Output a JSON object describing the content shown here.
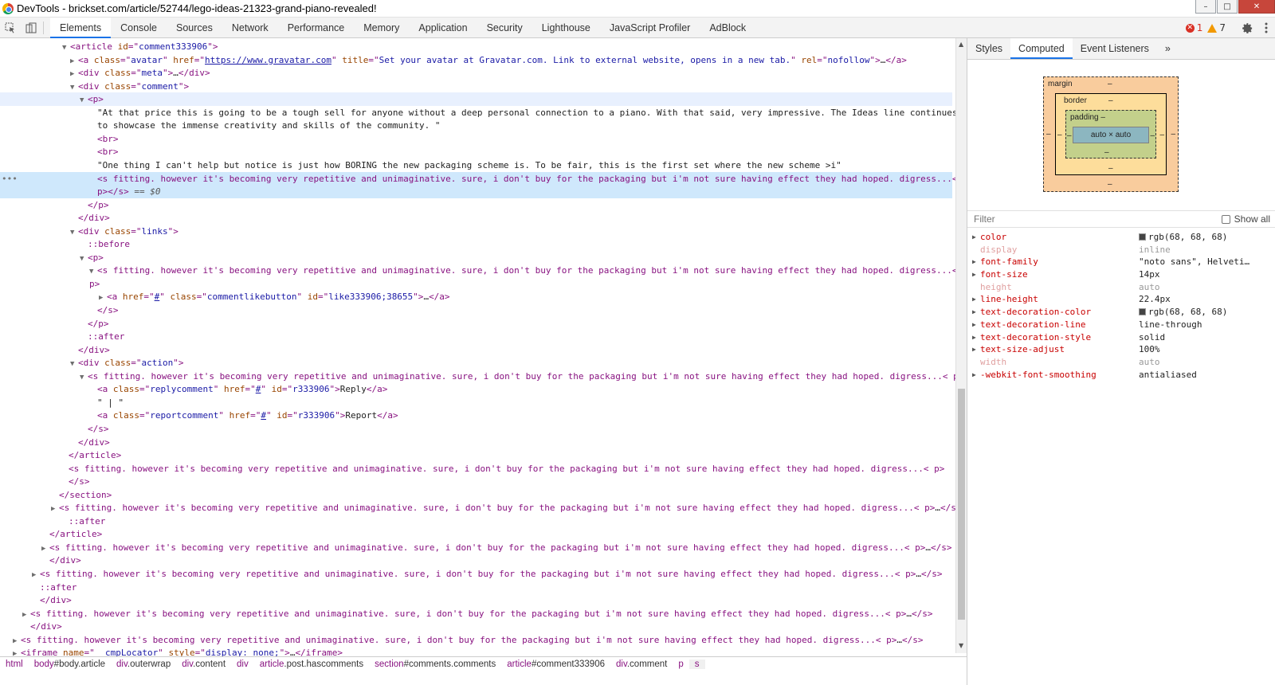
{
  "window": {
    "title": "DevTools - brickset.com/article/52744/lego-ideas-21323-grand-piano-revealed!",
    "min": "–",
    "max": "□",
    "close": "✕"
  },
  "toolbar": {
    "tabs": [
      "Elements",
      "Console",
      "Sources",
      "Network",
      "Performance",
      "Memory",
      "Application",
      "Security",
      "Lighthouse",
      "JavaScript Profiler",
      "AdBlock"
    ],
    "active_tab": "Elements",
    "errors": "1",
    "warnings": "7"
  },
  "dom_lines": [
    {
      "indent": 88,
      "arrow": "▼",
      "parts": [
        [
          "tag",
          "<article "
        ],
        [
          "attr",
          "id"
        ],
        [
          "tag",
          "=\""
        ],
        [
          "val",
          "comment333906"
        ],
        [
          "tag",
          "\">"
        ]
      ]
    },
    {
      "indent": 98,
      "arrow": "▶",
      "parts": [
        [
          "tag",
          "<a "
        ],
        [
          "attr",
          "class"
        ],
        [
          "tag",
          "=\""
        ],
        [
          "val",
          "avatar"
        ],
        [
          "tag",
          "\" "
        ],
        [
          "attr",
          "href"
        ],
        [
          "tag",
          "=\""
        ],
        [
          "link",
          "https://www.gravatar.com"
        ],
        [
          "tag",
          "\" "
        ],
        [
          "attr",
          "title"
        ],
        [
          "tag",
          "=\""
        ],
        [
          "val",
          "Set your avatar at Gravatar.com. Link to external website, opens in a new tab."
        ],
        [
          "tag",
          "\" "
        ],
        [
          "attr",
          "rel"
        ],
        [
          "tag",
          "=\""
        ],
        [
          "val",
          "nofollow"
        ],
        [
          "tag",
          "\">"
        ],
        [
          "txt",
          "…"
        ],
        [
          "tag",
          "</a>"
        ]
      ]
    },
    {
      "indent": 98,
      "arrow": "▶",
      "parts": [
        [
          "tag",
          "<div "
        ],
        [
          "attr",
          "class"
        ],
        [
          "tag",
          "=\""
        ],
        [
          "val",
          "meta"
        ],
        [
          "tag",
          "\">"
        ],
        [
          "txt",
          "…"
        ],
        [
          "tag",
          "</div>"
        ]
      ]
    },
    {
      "indent": 98,
      "arrow": "▼",
      "parts": [
        [
          "tag",
          "<div "
        ],
        [
          "attr",
          "class"
        ],
        [
          "tag",
          "=\""
        ],
        [
          "val",
          "comment"
        ],
        [
          "tag",
          "\">"
        ]
      ]
    },
    {
      "indent": 110,
      "arrow": "▼",
      "hover": true,
      "parts": [
        [
          "tag",
          "<p>"
        ]
      ]
    },
    {
      "indent": 122,
      "arrow": "",
      "parts": [
        [
          "txt",
          "\"At that price this is going to be a tough sell for anyone without a deep personal connection to a piano. With that said, very impressive. The Ideas line continues"
        ]
      ]
    },
    {
      "indent": 122,
      "arrow": "",
      "parts": [
        [
          "txt",
          "to showcase the immense creativity and skills of the community. \""
        ]
      ]
    },
    {
      "indent": 122,
      "arrow": "",
      "parts": [
        [
          "tag",
          "<br>"
        ]
      ]
    },
    {
      "indent": 122,
      "arrow": "",
      "parts": [
        [
          "tag",
          "<br>"
        ]
      ]
    },
    {
      "indent": 122,
      "arrow": "",
      "parts": [
        [
          "txt",
          "\"One thing I can't help but notice is just how BORING the new packaging scheme is. To be fair, this is the first set where the new scheme >i\""
        ]
      ]
    },
    {
      "indent": 122,
      "arrow": "",
      "selected": true,
      "dots": "•••",
      "parts": [
        [
          "tag",
          "<s fitting. however it's becoming very repetitive and unimaginative. sure, i don't buy for the packaging but i'm not sure having effect they had hoped. digress...<"
        ]
      ]
    },
    {
      "indent": 122,
      "arrow": "",
      "selected": true,
      "parts": [
        [
          "tag",
          "p></s>"
        ],
        [
          "dim",
          " == $0"
        ]
      ]
    },
    {
      "indent": 110,
      "arrow": "",
      "parts": [
        [
          "tag",
          "</p>"
        ]
      ]
    },
    {
      "indent": 98,
      "arrow": "",
      "parts": [
        [
          "tag",
          "</div>"
        ]
      ]
    },
    {
      "indent": 98,
      "arrow": "▼",
      "parts": [
        [
          "tag",
          "<div "
        ],
        [
          "attr",
          "class"
        ],
        [
          "tag",
          "=\""
        ],
        [
          "val",
          "links"
        ],
        [
          "tag",
          "\">"
        ]
      ]
    },
    {
      "indent": 110,
      "arrow": "",
      "parts": [
        [
          "pseudo",
          "::before"
        ]
      ]
    },
    {
      "indent": 110,
      "arrow": "▼",
      "parts": [
        [
          "tag",
          "<p>"
        ]
      ]
    },
    {
      "indent": 122,
      "arrow": "▼",
      "parts": [
        [
          "tag",
          "<s fitting. however it's becoming very repetitive and unimaginative. sure, i don't buy for the packaging but i'm not sure having effect they had hoped. digress...<"
        ]
      ]
    },
    {
      "indent": 112,
      "arrow": "",
      "parts": [
        [
          "tag",
          "p>"
        ]
      ]
    },
    {
      "indent": 134,
      "arrow": "▶",
      "parts": [
        [
          "tag",
          "<a "
        ],
        [
          "attr",
          "href"
        ],
        [
          "tag",
          "=\""
        ],
        [
          "link",
          "#"
        ],
        [
          "tag",
          "\" "
        ],
        [
          "attr",
          "class"
        ],
        [
          "tag",
          "=\""
        ],
        [
          "val",
          "commentlikebutton"
        ],
        [
          "tag",
          "\" "
        ],
        [
          "attr",
          "id"
        ],
        [
          "tag",
          "=\""
        ],
        [
          "val",
          "like333906;38655"
        ],
        [
          "tag",
          "\">"
        ],
        [
          "txt",
          "…"
        ],
        [
          "tag",
          "</a>"
        ]
      ]
    },
    {
      "indent": 122,
      "arrow": "",
      "parts": [
        [
          "tag",
          "</s>"
        ]
      ]
    },
    {
      "indent": 110,
      "arrow": "",
      "parts": [
        [
          "tag",
          "</p>"
        ]
      ]
    },
    {
      "indent": 110,
      "arrow": "",
      "parts": [
        [
          "pseudo",
          "::after"
        ]
      ]
    },
    {
      "indent": 98,
      "arrow": "",
      "parts": [
        [
          "tag",
          "</div>"
        ]
      ]
    },
    {
      "indent": 98,
      "arrow": "▼",
      "parts": [
        [
          "tag",
          "<div "
        ],
        [
          "attr",
          "class"
        ],
        [
          "tag",
          "=\""
        ],
        [
          "val",
          "action"
        ],
        [
          "tag",
          "\">"
        ]
      ]
    },
    {
      "indent": 110,
      "arrow": "▼",
      "parts": [
        [
          "tag",
          "<s fitting. however it's becoming very repetitive and unimaginative. sure, i don't buy for the packaging but i'm not sure having effect they had hoped. digress...< p>"
        ]
      ]
    },
    {
      "indent": 122,
      "arrow": "",
      "parts": [
        [
          "tag",
          "<a "
        ],
        [
          "attr",
          "class"
        ],
        [
          "tag",
          "=\""
        ],
        [
          "val",
          "replycomment"
        ],
        [
          "tag",
          "\" "
        ],
        [
          "attr",
          "href"
        ],
        [
          "tag",
          "=\""
        ],
        [
          "link",
          "#"
        ],
        [
          "tag",
          "\" "
        ],
        [
          "attr",
          "id"
        ],
        [
          "tag",
          "=\""
        ],
        [
          "val",
          "r333906"
        ],
        [
          "tag",
          "\">"
        ],
        [
          "txt",
          "Reply"
        ],
        [
          "tag",
          "</a>"
        ]
      ]
    },
    {
      "indent": 122,
      "arrow": "",
      "parts": [
        [
          "txt",
          "\" | \""
        ]
      ]
    },
    {
      "indent": 122,
      "arrow": "",
      "parts": [
        [
          "tag",
          "<a "
        ],
        [
          "attr",
          "class"
        ],
        [
          "tag",
          "=\""
        ],
        [
          "val",
          "reportcomment"
        ],
        [
          "tag",
          "\" "
        ],
        [
          "attr",
          "href"
        ],
        [
          "tag",
          "=\""
        ],
        [
          "link",
          "#"
        ],
        [
          "tag",
          "\" "
        ],
        [
          "attr",
          "id"
        ],
        [
          "tag",
          "=\""
        ],
        [
          "val",
          "r333906"
        ],
        [
          "tag",
          "\">"
        ],
        [
          "txt",
          "Report"
        ],
        [
          "tag",
          "</a>"
        ]
      ]
    },
    {
      "indent": 110,
      "arrow": "",
      "parts": [
        [
          "tag",
          "</s>"
        ]
      ]
    },
    {
      "indent": 98,
      "arrow": "",
      "parts": [
        [
          "tag",
          "</div>"
        ]
      ]
    },
    {
      "indent": 86,
      "arrow": "",
      "parts": [
        [
          "tag",
          "</article>"
        ]
      ]
    },
    {
      "indent": 86,
      "arrow": "",
      "parts": [
        [
          "tag",
          "<s fitting. however it's becoming very repetitive and unimaginative. sure, i don't buy for the packaging but i'm not sure having effect they had hoped. digress...< p>"
        ]
      ]
    },
    {
      "indent": 86,
      "arrow": "",
      "parts": [
        [
          "tag",
          "</s>"
        ]
      ]
    },
    {
      "indent": 74,
      "arrow": "",
      "parts": [
        [
          "tag",
          "</section>"
        ]
      ]
    },
    {
      "indent": 74,
      "arrow": "▶",
      "parts": [
        [
          "tag",
          "<s fitting. however it's becoming very repetitive and unimaginative. sure, i don't buy for the packaging but i'm not sure having effect they had hoped. digress...< p>"
        ],
        [
          "txt",
          "…"
        ],
        [
          "tag",
          "</s>"
        ]
      ]
    },
    {
      "indent": 86,
      "arrow": "",
      "parts": [
        [
          "pseudo",
          "::after"
        ]
      ]
    },
    {
      "indent": 62,
      "arrow": "",
      "parts": [
        [
          "tag",
          "</article>"
        ]
      ]
    },
    {
      "indent": 62,
      "arrow": "▶",
      "parts": [
        [
          "tag",
          "<s fitting. however it's becoming very repetitive and unimaginative. sure, i don't buy for the packaging but i'm not sure having effect they had hoped. digress...< p>"
        ],
        [
          "txt",
          "…"
        ],
        [
          "tag",
          "</s>"
        ]
      ]
    },
    {
      "indent": 62,
      "arrow": "",
      "parts": [
        [
          "tag",
          "</div>"
        ]
      ]
    },
    {
      "indent": 50,
      "arrow": "▶",
      "parts": [
        [
          "tag",
          "<s fitting. however it's becoming very repetitive and unimaginative. sure, i don't buy for the packaging but i'm not sure having effect they had hoped. digress...< p>"
        ],
        [
          "txt",
          "…"
        ],
        [
          "tag",
          "</s>"
        ]
      ]
    },
    {
      "indent": 50,
      "arrow": "",
      "parts": [
        [
          "pseudo",
          "::after"
        ]
      ]
    },
    {
      "indent": 50,
      "arrow": "",
      "parts": [
        [
          "tag",
          "</div>"
        ]
      ]
    },
    {
      "indent": 38,
      "arrow": "▶",
      "parts": [
        [
          "tag",
          "<s fitting. however it's becoming very repetitive and unimaginative. sure, i don't buy for the packaging but i'm not sure having effect they had hoped. digress...< p>"
        ],
        [
          "txt",
          "…"
        ],
        [
          "tag",
          "</s>"
        ]
      ]
    },
    {
      "indent": 38,
      "arrow": "",
      "parts": [
        [
          "tag",
          "</div>"
        ]
      ]
    },
    {
      "indent": 26,
      "arrow": "▶",
      "parts": [
        [
          "tag",
          "<s fitting. however it's becoming very repetitive and unimaginative. sure, i don't buy for the packaging but i'm not sure having effect they had hoped. digress...< p>"
        ],
        [
          "txt",
          "…"
        ],
        [
          "tag",
          "</s>"
        ]
      ]
    },
    {
      "indent": 26,
      "arrow": "▶",
      "parts": [
        [
          "tag",
          "<iframe "
        ],
        [
          "attr",
          "name"
        ],
        [
          "tag",
          "=\""
        ],
        [
          "val",
          "__cmpLocator"
        ],
        [
          "tag",
          "\" "
        ],
        [
          "attr",
          "style"
        ],
        [
          "tag",
          "=\""
        ],
        [
          "val",
          "display: none;"
        ],
        [
          "tag",
          "\">"
        ],
        [
          "txt",
          "…"
        ],
        [
          "tag",
          "</iframe>"
        ]
      ]
    }
  ],
  "breadcrumbs": [
    {
      "tag": "html",
      "id": ""
    },
    {
      "tag": "body",
      "id": "#body.article"
    },
    {
      "tag": "div",
      "id": ".outerwrap"
    },
    {
      "tag": "div",
      "id": ".content"
    },
    {
      "tag": "div",
      "id": ""
    },
    {
      "tag": "article",
      "id": ".post.hascomments"
    },
    {
      "tag": "section",
      "id": "#comments.comments"
    },
    {
      "tag": "article",
      "id": "#comment333906"
    },
    {
      "tag": "div",
      "id": ".comment"
    },
    {
      "tag": "p",
      "id": ""
    },
    {
      "tag": "s",
      "id": ""
    }
  ],
  "sidebar": {
    "tabs": [
      "Styles",
      "Computed",
      "Event Listeners"
    ],
    "active_tab": "Computed",
    "more": "»",
    "boxmodel": {
      "margin_label": "margin",
      "border_label": "border",
      "padding_label": "padding",
      "content": "auto × auto",
      "dash": "–"
    },
    "filter_placeholder": "Filter",
    "show_all": "Show all",
    "properties": [
      {
        "name": "color",
        "value": "rgb(68, 68, 68)",
        "swatch": "#444444",
        "inherited": false,
        "arrow": true
      },
      {
        "name": "display",
        "value": "inline",
        "inherited": true,
        "arrow": false
      },
      {
        "name": "font-family",
        "value": "\"noto sans\", Helveti…",
        "inherited": false,
        "arrow": true
      },
      {
        "name": "font-size",
        "value": "14px",
        "inherited": false,
        "arrow": true
      },
      {
        "name": "height",
        "value": "auto",
        "inherited": true,
        "arrow": false
      },
      {
        "name": "line-height",
        "value": "22.4px",
        "inherited": false,
        "arrow": true
      },
      {
        "name": "text-decoration-color",
        "value": "rgb(68, 68, 68)",
        "swatch": "#444444",
        "inherited": false,
        "arrow": true
      },
      {
        "name": "text-decoration-line",
        "value": "line-through",
        "inherited": false,
        "arrow": true
      },
      {
        "name": "text-decoration-style",
        "value": "solid",
        "inherited": false,
        "arrow": true
      },
      {
        "name": "text-size-adjust",
        "value": "100%",
        "inherited": false,
        "arrow": true
      },
      {
        "name": "width",
        "value": "auto",
        "inherited": true,
        "arrow": false
      },
      {
        "name": "-webkit-font-smoothing",
        "value": "antialiased",
        "inherited": false,
        "arrow": true
      }
    ]
  }
}
